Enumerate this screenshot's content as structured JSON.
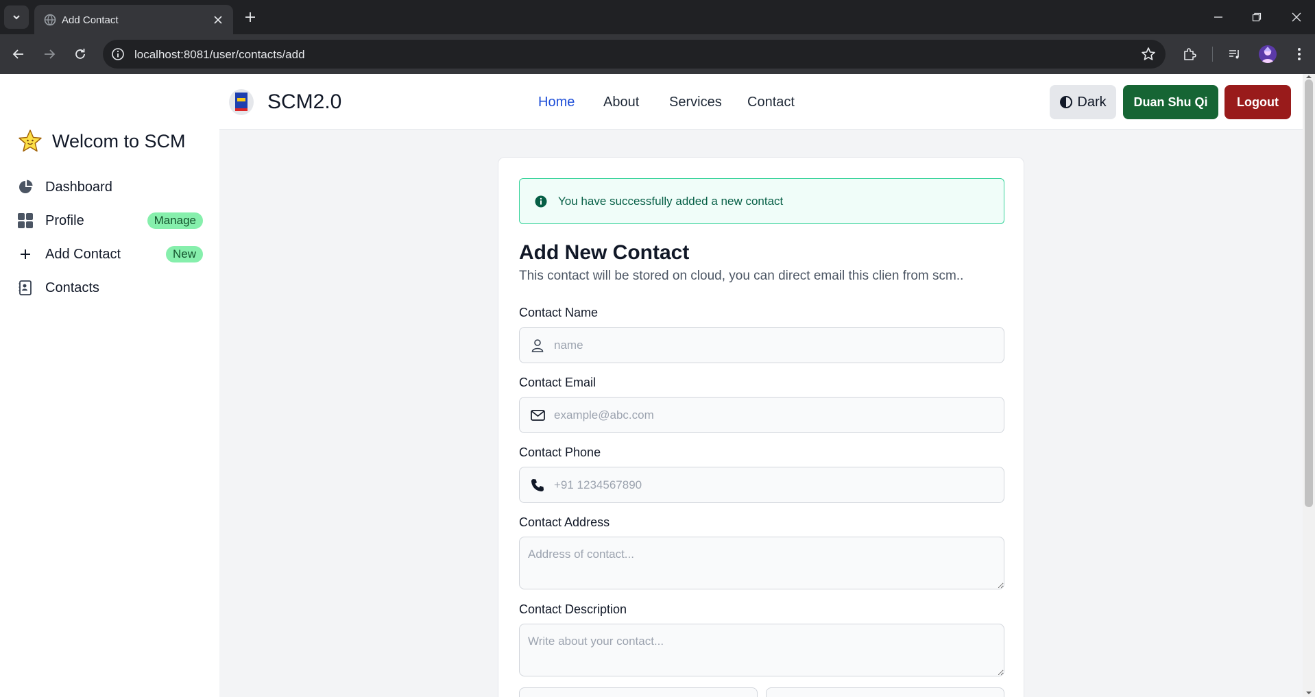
{
  "browser": {
    "tab_title": "Add Contact",
    "url": "localhost:8081/user/contacts/add"
  },
  "sidebar": {
    "welcome": "Welcom to SCM",
    "items": [
      {
        "label": "Dashboard",
        "icon": "pie-chart-icon"
      },
      {
        "label": "Profile",
        "icon": "grid-icon",
        "badge": "Manage"
      },
      {
        "label": "Add Contact",
        "icon": "plus-icon",
        "badge": "New"
      },
      {
        "label": "Contacts",
        "icon": "contact-card-icon"
      }
    ]
  },
  "navbar": {
    "brand": "SCM2.0",
    "links": [
      "Home",
      "About",
      "Services",
      "Contact"
    ],
    "active_link": "Home",
    "dark_label": "Dark",
    "user_label": "Duan Shu Qi",
    "logout_label": "Logout"
  },
  "alert": {
    "message": "You have successfully added a new contact"
  },
  "form": {
    "title": "Add New Contact",
    "subtitle": "This contact will be stored on cloud, you can direct email this clien from scm..",
    "name_label": "Contact Name",
    "name_placeholder": "name",
    "email_label": "Contact Email",
    "email_placeholder": "example@abc.com",
    "phone_label": "Contact Phone",
    "phone_placeholder": "+91 1234567890",
    "address_label": "Contact Address",
    "address_placeholder": "Address of contact...",
    "description_label": "Contact Description",
    "description_placeholder": "Write about your contact..."
  },
  "colors": {
    "user_button": "#166534",
    "logout_button": "#991b1b",
    "badge": "#86efac",
    "active_link": "#1d4ed8",
    "alert_border": "#34d399"
  }
}
